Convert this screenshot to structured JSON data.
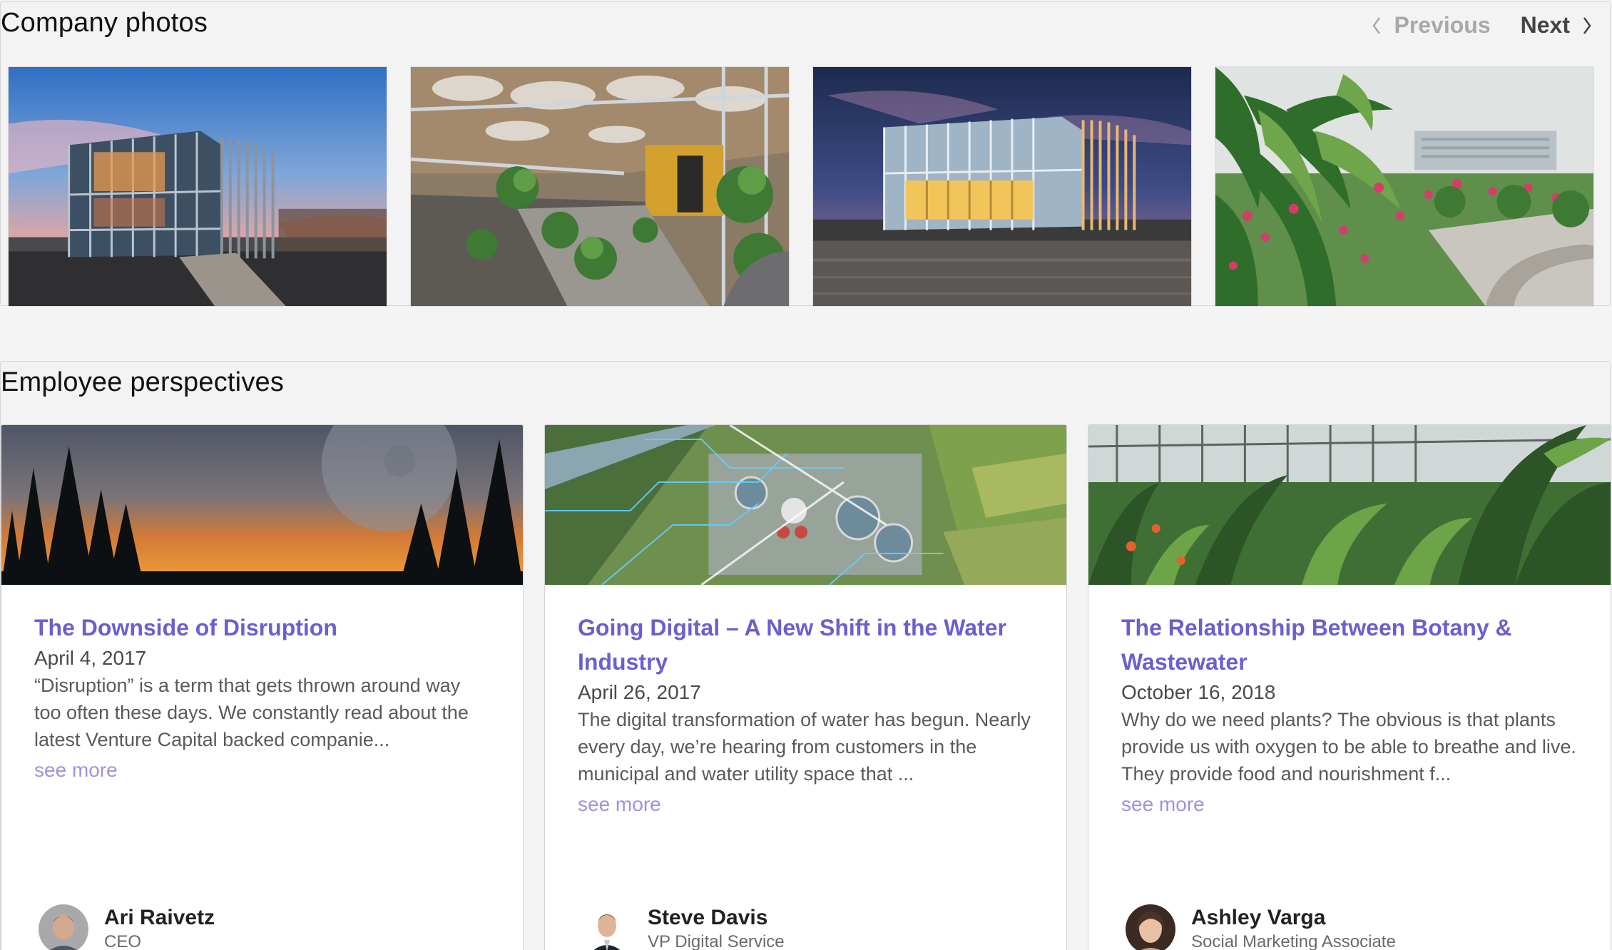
{
  "company_photos": {
    "title": "Company photos",
    "pager": {
      "previous_label": "Previous",
      "next_label": "Next",
      "previous_enabled": false,
      "next_enabled": true
    },
    "photos": [
      {
        "subject": "glass-pavilion-sunset"
      },
      {
        "subject": "greenhouse-interior-walkway"
      },
      {
        "subject": "glass-pavilion-night"
      },
      {
        "subject": "garden-with-flowers"
      }
    ]
  },
  "employee_perspectives": {
    "title": "Employee perspectives",
    "cards": [
      {
        "title": "The Downside of Disruption",
        "date": "April 4, 2017",
        "excerpt": "“Disruption” is a term that gets thrown around way too often these days. We constantly read about the latest Venture Capital backed companie...",
        "see_more": "see more",
        "author_name": "Ari Raivetz",
        "author_role": "CEO"
      },
      {
        "title": "Going Digital – A New Shift in the Water Industry",
        "date": "April 26, 2017",
        "excerpt": "The digital transformation of water has begun. Nearly every day, we’re hearing from customers in the municipal and water utility space that ...",
        "see_more": "see more",
        "author_name": "Steve Davis",
        "author_role": "VP Digital Service"
      },
      {
        "title": "The Relationship Between Botany & Wastewater",
        "date": "October 16, 2018",
        "excerpt": "Why do we need plants? The obvious is that plants provide us with oxygen to be able to breathe and live. They provide food and nourishment f...",
        "see_more": "see more",
        "author_name": "Ashley Varga",
        "author_role": "Social Marketing Associate"
      }
    ]
  },
  "colors": {
    "link": "#6b5fcf",
    "see_more": "#9d93e0",
    "pager_disabled": "#a9a9a9",
    "pager_enabled": "#444444",
    "background": "#f4f4f4"
  }
}
